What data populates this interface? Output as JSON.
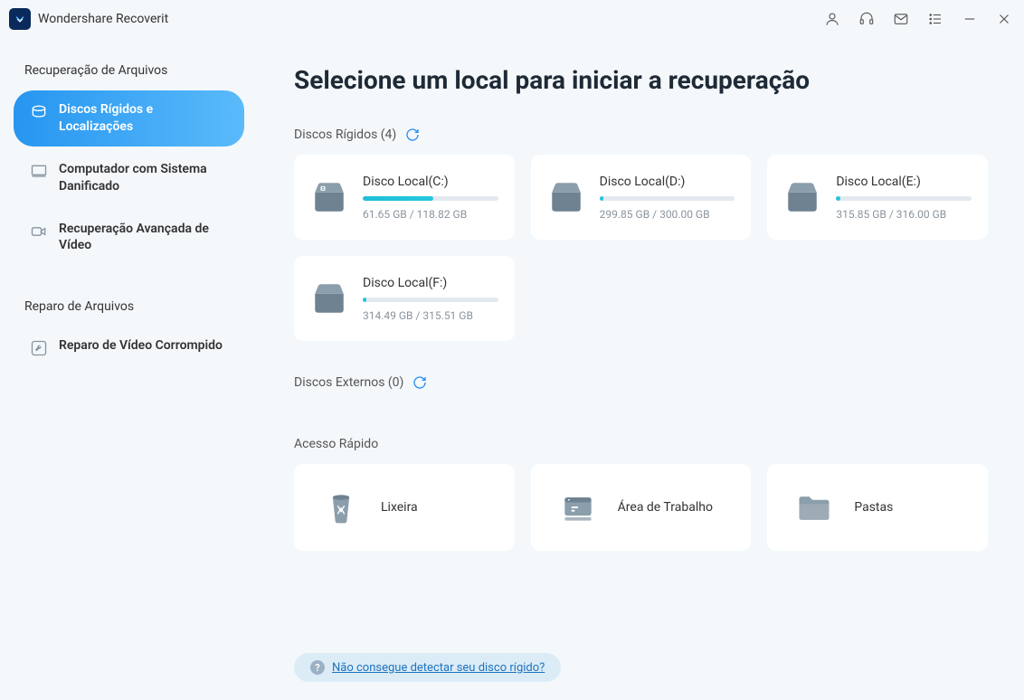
{
  "app": {
    "title": "Wondershare Recoverit"
  },
  "sidebar": {
    "section1_title": "Recuperação de Arquivos",
    "section2_title": "Reparo de Arquivos",
    "items1": [
      {
        "label": "Discos Rígidos e Localizações"
      },
      {
        "label": "Computador com Sistema Danificado"
      },
      {
        "label": "Recuperação Avançada de Vídeo"
      }
    ],
    "items2": [
      {
        "label": "Reparo de Vídeo Corrompido"
      }
    ]
  },
  "main": {
    "title": "Selecione um local para iniciar a recuperação",
    "hard_disks_label": "Discos Rígidos (4)",
    "external_disks_label": "Discos Externos (0)",
    "quick_access_label": "Acesso Rápido",
    "disks": [
      {
        "name": "Disco Local(C:)",
        "capacity": "61.65 GB / 118.82 GB",
        "fill_pct": 52,
        "system": true
      },
      {
        "name": "Disco Local(D:)",
        "capacity": "299.85 GB / 300.00 GB",
        "fill_pct": 2,
        "system": false
      },
      {
        "name": "Disco Local(E:)",
        "capacity": "315.85 GB / 316.00 GB",
        "fill_pct": 2,
        "system": false
      },
      {
        "name": "Disco Local(F:)",
        "capacity": "314.49 GB / 315.51 GB",
        "fill_pct": 2,
        "system": false
      }
    ],
    "quick": [
      {
        "label": "Lixeira",
        "icon": "recycle-bin"
      },
      {
        "label": "Área de Trabalho",
        "icon": "desktop"
      },
      {
        "label": "Pastas",
        "icon": "folder"
      }
    ],
    "help_link": "Não consegue detectar seu disco rígido?"
  }
}
